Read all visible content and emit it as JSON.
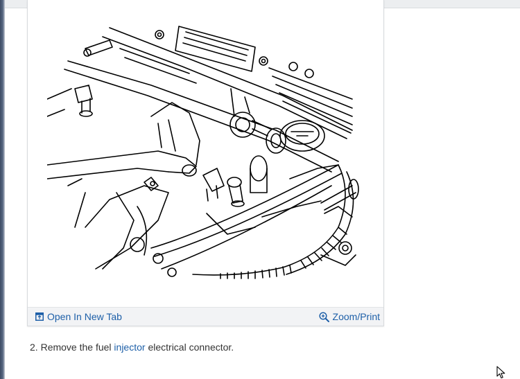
{
  "figure": {
    "open_tab_label": "Open In New Tab",
    "zoom_label": "Zoom/Print"
  },
  "step": {
    "number": "2.",
    "text_before": "Remove the fuel",
    "link_text": "injector",
    "text_after": "electrical connector."
  },
  "colors": {
    "link": "#1d5fa8",
    "text": "#333333",
    "footer_bg": "#f2f3f5"
  },
  "icons": {
    "open_tab": "open-new-tab-icon",
    "zoom": "magnifier-plus-icon",
    "cursor": "mouse-pointer-icon"
  }
}
